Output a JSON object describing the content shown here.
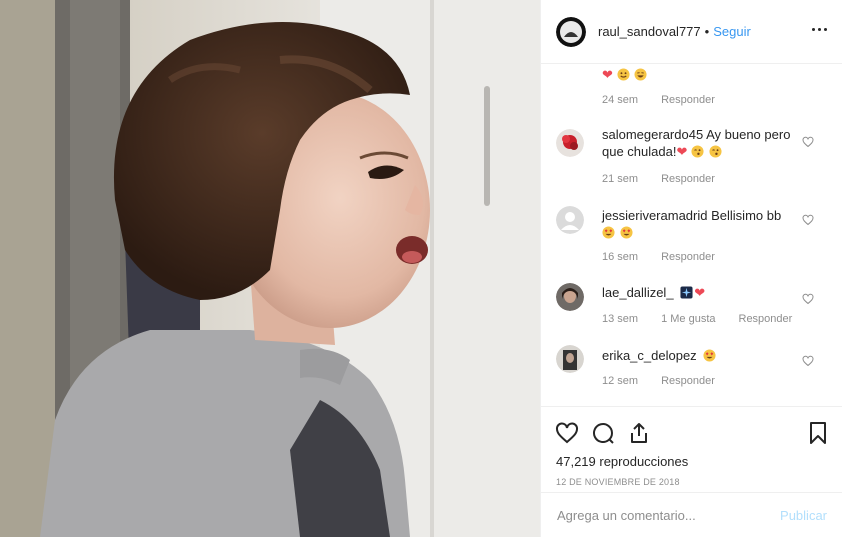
{
  "header": {
    "username": "raul_sandoval777",
    "separator": "•",
    "follow_label": "Seguir"
  },
  "comments": [
    {
      "username": "",
      "text": "",
      "emojis": [
        "heart",
        "smile-face",
        "laugh-face"
      ],
      "time": "24 sem",
      "likes": "",
      "reply_label": "Responder",
      "partial": true
    },
    {
      "username": "salomegerardo45",
      "text": "Ay bueno pero que chulada!",
      "emojis": [
        "heart",
        "kiss-face",
        "kiss-face"
      ],
      "time": "21 sem",
      "likes": "",
      "reply_label": "Responder",
      "avatar": "red-flower-avatar"
    },
    {
      "username": "jessieriveramadrid",
      "text": "Bellisimo bb",
      "emojis": [
        "heart-eyes-face",
        "heart-eyes-face"
      ],
      "time": "16 sem",
      "likes": "",
      "reply_label": "Responder",
      "avatar": "default-gray-avatar"
    },
    {
      "username": "lae_dallizel_",
      "text": "",
      "emojis": [
        "sparkle-box",
        "heart"
      ],
      "time": "13 sem",
      "likes": "1 Me gusta",
      "reply_label": "Responder",
      "avatar": "photo-avatar"
    },
    {
      "username": "erika_c_delopez",
      "text": "",
      "emojis": [
        "heart-eyes-face"
      ],
      "time": "12 sem",
      "likes": "",
      "reply_label": "Responder",
      "avatar": "dark-photo-avatar"
    }
  ],
  "actions": {
    "like_icon": "heart-outline-icon",
    "comment_icon": "comment-bubble-icon",
    "share_icon": "share-upload-icon",
    "save_icon": "bookmark-icon",
    "views": "47,219 reproducciones",
    "date": "12 DE NOVIEMBRE DE 2018"
  },
  "comment_box": {
    "placeholder": "Agrega un comentario...",
    "post_label": "Publicar"
  },
  "colors": {
    "link_blue": "#3897f0",
    "muted_text": "#8e8e8e",
    "heart_red": "#ed4956",
    "publish_disabled": "#b2dffc",
    "border": "#efefef"
  }
}
